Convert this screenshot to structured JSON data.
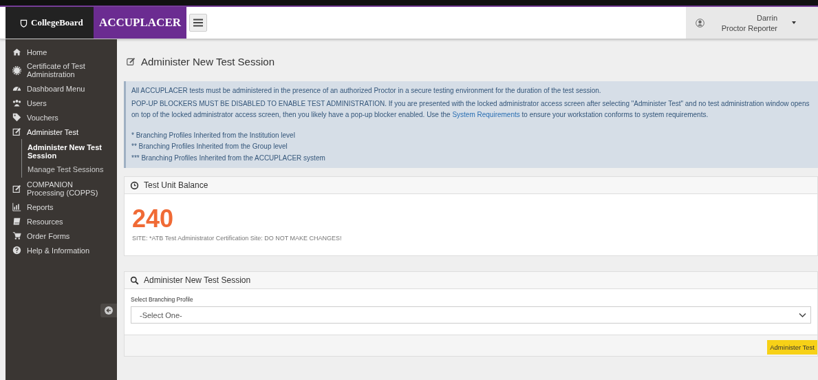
{
  "header": {
    "brand": "CollegeBoard",
    "product": "ACCUPLACER",
    "user": {
      "name": "Darrin",
      "role": "Proctor Reporter"
    }
  },
  "sidebar": {
    "items": [
      {
        "label": "Home",
        "expanded": false
      },
      {
        "label": "Certificate of Test Administration",
        "expanded": false
      },
      {
        "label": "Dashboard Menu",
        "expanded": false
      },
      {
        "label": "Users",
        "expanded": false
      },
      {
        "label": "Vouchers",
        "expanded": false
      },
      {
        "label": "Administer Test",
        "expanded": true,
        "children": [
          {
            "label": "Administer New Test Session",
            "selected": true
          },
          {
            "label": "Manage Test Sessions",
            "selected": false
          }
        ]
      },
      {
        "label": "COMPANION Processing (COPPS)",
        "expanded": false
      },
      {
        "label": "Reports",
        "expanded": false
      },
      {
        "label": "Resources",
        "expanded": false
      },
      {
        "label": "Order Forms",
        "expanded": false
      },
      {
        "label": "Help & Information",
        "expanded": false
      }
    ]
  },
  "page_title": "Administer New Test Session",
  "notice": {
    "line_1": "All ACCUPLACER tests must be administered in the presence of an authorized Proctor in a secure testing environment for the duration of the test session.",
    "line_2_before": "POP-UP BLOCKERS MUST BE DISABLED TO ENABLE TEST ADMINISTRATION. If you are presented with the locked administrator access screen after selecting \"Administer Test\" and no test administration window opens on top of the locked administrator access screen, then you likely have a pop-up blocker enabled. Use the",
    "line_2_link": "System Requirements",
    "line_2_after": "to ensure your workstation conforms to system requirements.",
    "footnotes": [
      "* Branching Profiles Inherited from the Institution level",
      "** Branching Profiles Inherited from the Group level",
      "*** Branching Profiles Inherited from the ACCUPLACER system"
    ]
  },
  "balance_panel": {
    "title": "Test Unit Balance",
    "value": "240",
    "site": "SITE: *ATB Test Administrator Certification Site: DO NOT MAKE CHANGES!"
  },
  "session_panel": {
    "title": "Administer New Test Session",
    "field_label": "Select Branching Profile",
    "select_value": "-Select One-",
    "button": "Administer Test"
  }
}
